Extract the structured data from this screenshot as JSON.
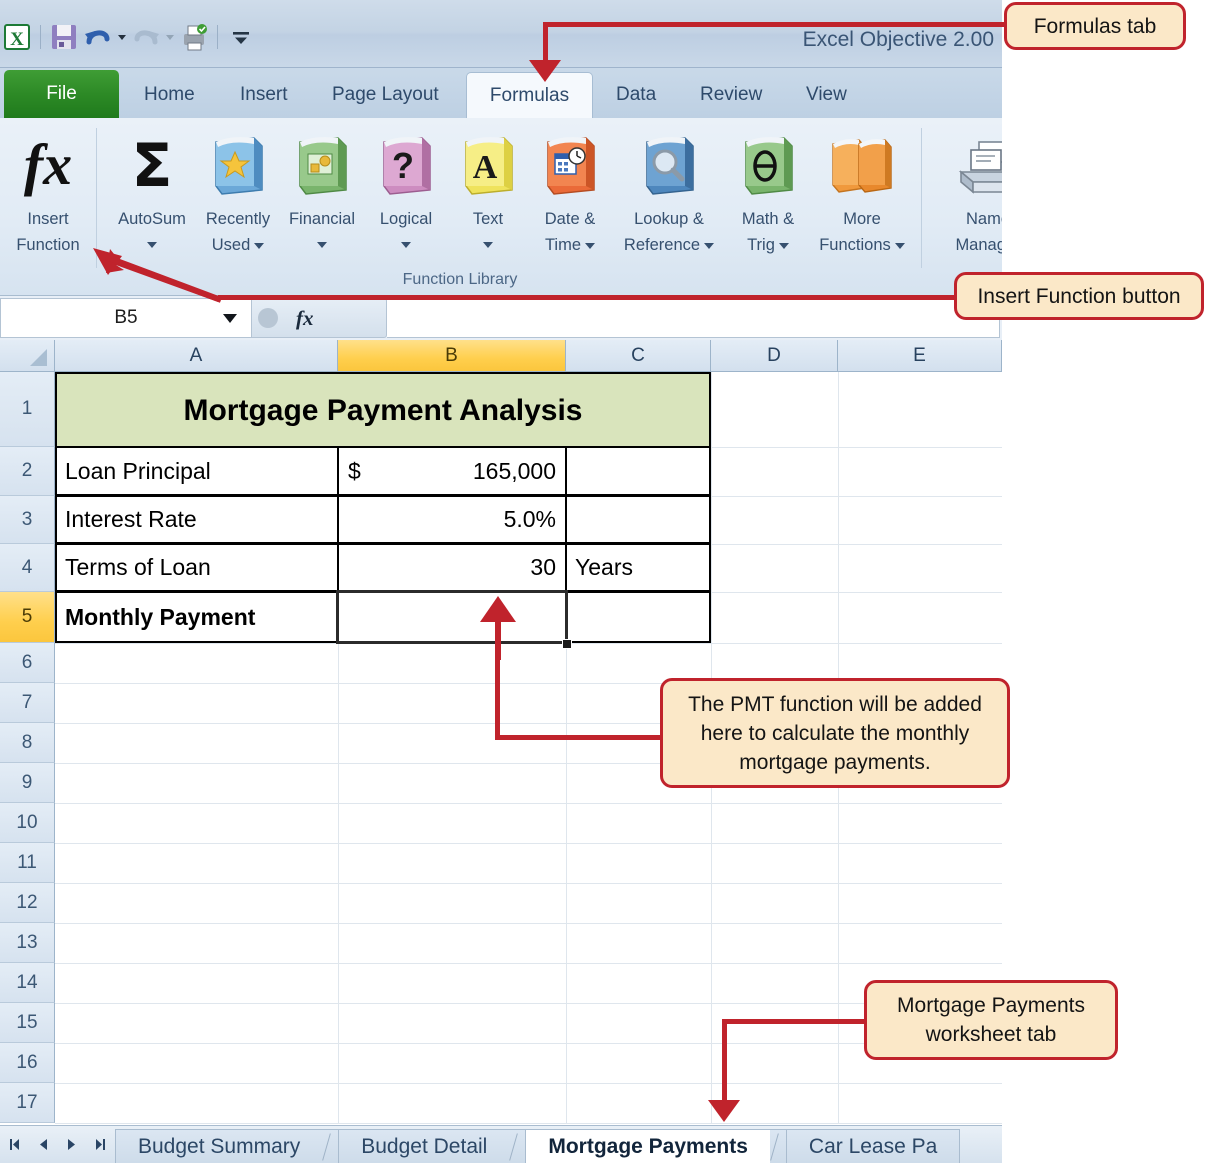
{
  "window": {
    "title": "Excel Objective 2.00",
    "quick_access": [
      {
        "name": "excel-logo-icon",
        "label": "Excel"
      },
      {
        "name": "save-icon",
        "label": "Save"
      },
      {
        "name": "undo-icon",
        "label": "Undo"
      },
      {
        "name": "redo-icon",
        "label": "Redo"
      },
      {
        "name": "print-preview-icon",
        "label": "Print Preview and Print"
      },
      {
        "name": "customize-qat-icon",
        "label": "Customize Quick Access Toolbar"
      }
    ]
  },
  "ribbon": {
    "tabs": [
      {
        "label": "File",
        "active": false,
        "kind": "file"
      },
      {
        "label": "Home",
        "active": false
      },
      {
        "label": "Insert",
        "active": false
      },
      {
        "label": "Page Layout",
        "active": false
      },
      {
        "label": "Formulas",
        "active": true
      },
      {
        "label": "Data",
        "active": false
      },
      {
        "label": "Review",
        "active": false
      },
      {
        "label": "View",
        "active": false
      }
    ],
    "group_title": "Function Library",
    "items": [
      {
        "label_line1": "Insert",
        "label_line2": "Function",
        "icon": "fx-icon",
        "dropdown": false
      },
      {
        "label_line1": "AutoSum",
        "label_line2": "",
        "icon": "sigma-icon",
        "dropdown": true
      },
      {
        "label_line1": "Recently",
        "label_line2": "Used",
        "icon": "blue-book-star-icon",
        "dropdown": true
      },
      {
        "label_line1": "Financial",
        "label_line2": "",
        "icon": "green-book-money-icon",
        "dropdown": true
      },
      {
        "label_line1": "Logical",
        "label_line2": "",
        "icon": "pink-book-question-icon",
        "dropdown": true
      },
      {
        "label_line1": "Text",
        "label_line2": "",
        "icon": "yellow-book-a-icon",
        "dropdown": true
      },
      {
        "label_line1": "Date &",
        "label_line2": "Time",
        "icon": "orange-book-calendar-icon",
        "dropdown": true
      },
      {
        "label_line1": "Lookup &",
        "label_line2": "Reference",
        "icon": "blue-book-magnifier-icon",
        "dropdown": true
      },
      {
        "label_line1": "Math &",
        "label_line2": "Trig",
        "icon": "green-book-theta-icon",
        "dropdown": true
      },
      {
        "label_line1": "More",
        "label_line2": "Functions",
        "icon": "orange-books-icon",
        "dropdown": true
      },
      {
        "label_line1": "Name",
        "label_line2": "Manager",
        "icon": "name-manager-icon",
        "dropdown": false
      }
    ]
  },
  "formula_bar": {
    "name_box_value": "B5",
    "formula_value": "",
    "fx_label": "fx"
  },
  "sheet": {
    "columns": [
      "A",
      "B",
      "C",
      "D",
      "E"
    ],
    "selected_column": "B",
    "rows": [
      "1",
      "2",
      "3",
      "4",
      "5",
      "6",
      "7",
      "8",
      "9",
      "10",
      "11",
      "12",
      "13",
      "14",
      "15",
      "16",
      "17"
    ],
    "selected_row": "5",
    "active_cell": "B5",
    "title_banner": "Mortgage Payment Analysis",
    "data_rows": [
      {
        "row": "2",
        "a": "Loan Principal",
        "b_symbol": "$",
        "b": "165,000",
        "c": ""
      },
      {
        "row": "3",
        "a": "Interest Rate",
        "b_symbol": "",
        "b": "5.0%",
        "c": ""
      },
      {
        "row": "4",
        "a": "Terms of Loan",
        "b_symbol": "",
        "b": "30",
        "c": "Years"
      },
      {
        "row": "5",
        "a": "Monthly Payment",
        "b_symbol": "",
        "b": "",
        "c": ""
      }
    ]
  },
  "sheet_tabs": {
    "nav": [
      "first-sheet",
      "prev-sheet",
      "next-sheet",
      "last-sheet"
    ],
    "tabs": [
      {
        "label": "Budget Summary",
        "active": false
      },
      {
        "label": "Budget Detail",
        "active": false
      },
      {
        "label": "Mortgage Payments",
        "active": true
      },
      {
        "label": "Car Lease Pa",
        "active": false
      }
    ]
  },
  "callouts": [
    {
      "id": "formulas-tab",
      "text": "Formulas tab"
    },
    {
      "id": "insert-function",
      "text": "Insert Function button"
    },
    {
      "id": "pmt-note",
      "text": "The PMT function will be added here to calculate the monthly mortgage payments."
    },
    {
      "id": "worksheet-tab-note",
      "text": "Mortgage Payments worksheet tab"
    }
  ],
  "colors": {
    "annotation_red": "#c0232c",
    "callout_fill": "#fbe8c8",
    "title_banner_green": "#d9e4bc",
    "selected_header_yellow": "#fbc63d",
    "file_tab_green": "#2d8a26"
  }
}
